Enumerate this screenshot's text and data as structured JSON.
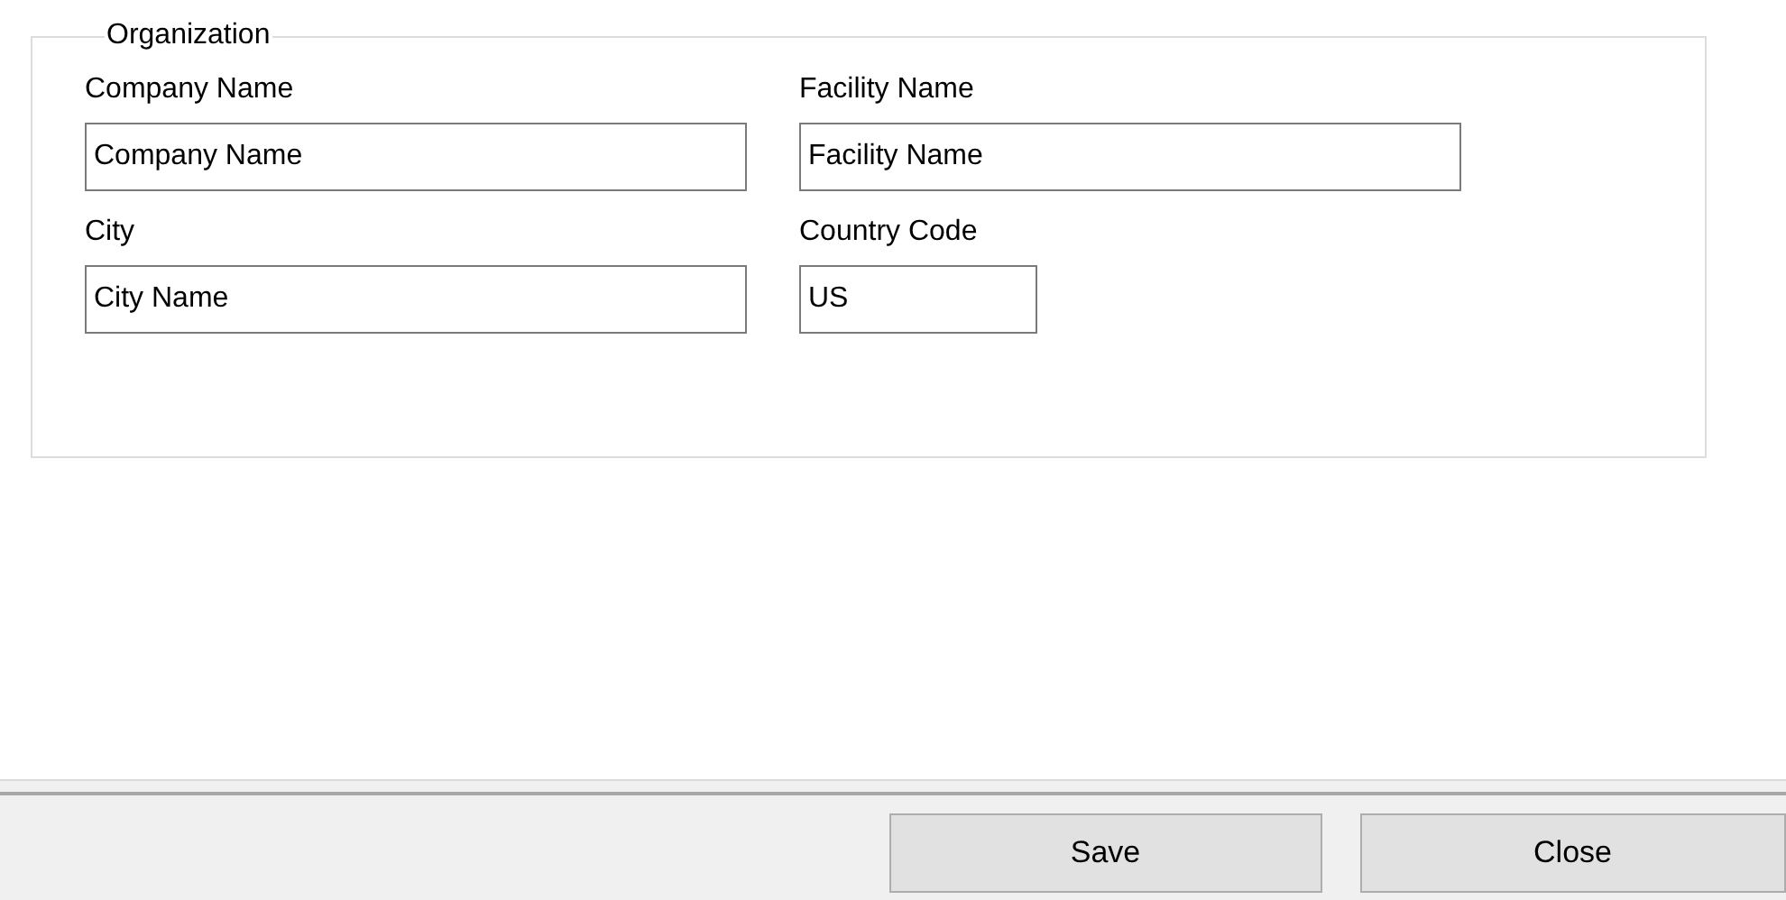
{
  "group": {
    "title": "Organization"
  },
  "fields": [
    {
      "label": "Company Name",
      "value": "Company Name",
      "kind": "wide"
    },
    {
      "label": "Facility Name",
      "value": "Facility Name",
      "kind": "wide"
    },
    {
      "label": "City",
      "value": "City Name",
      "kind": "wide"
    },
    {
      "label": "Country Code",
      "value": "US",
      "kind": "short"
    }
  ],
  "buttons": [
    "Save",
    "Close"
  ]
}
